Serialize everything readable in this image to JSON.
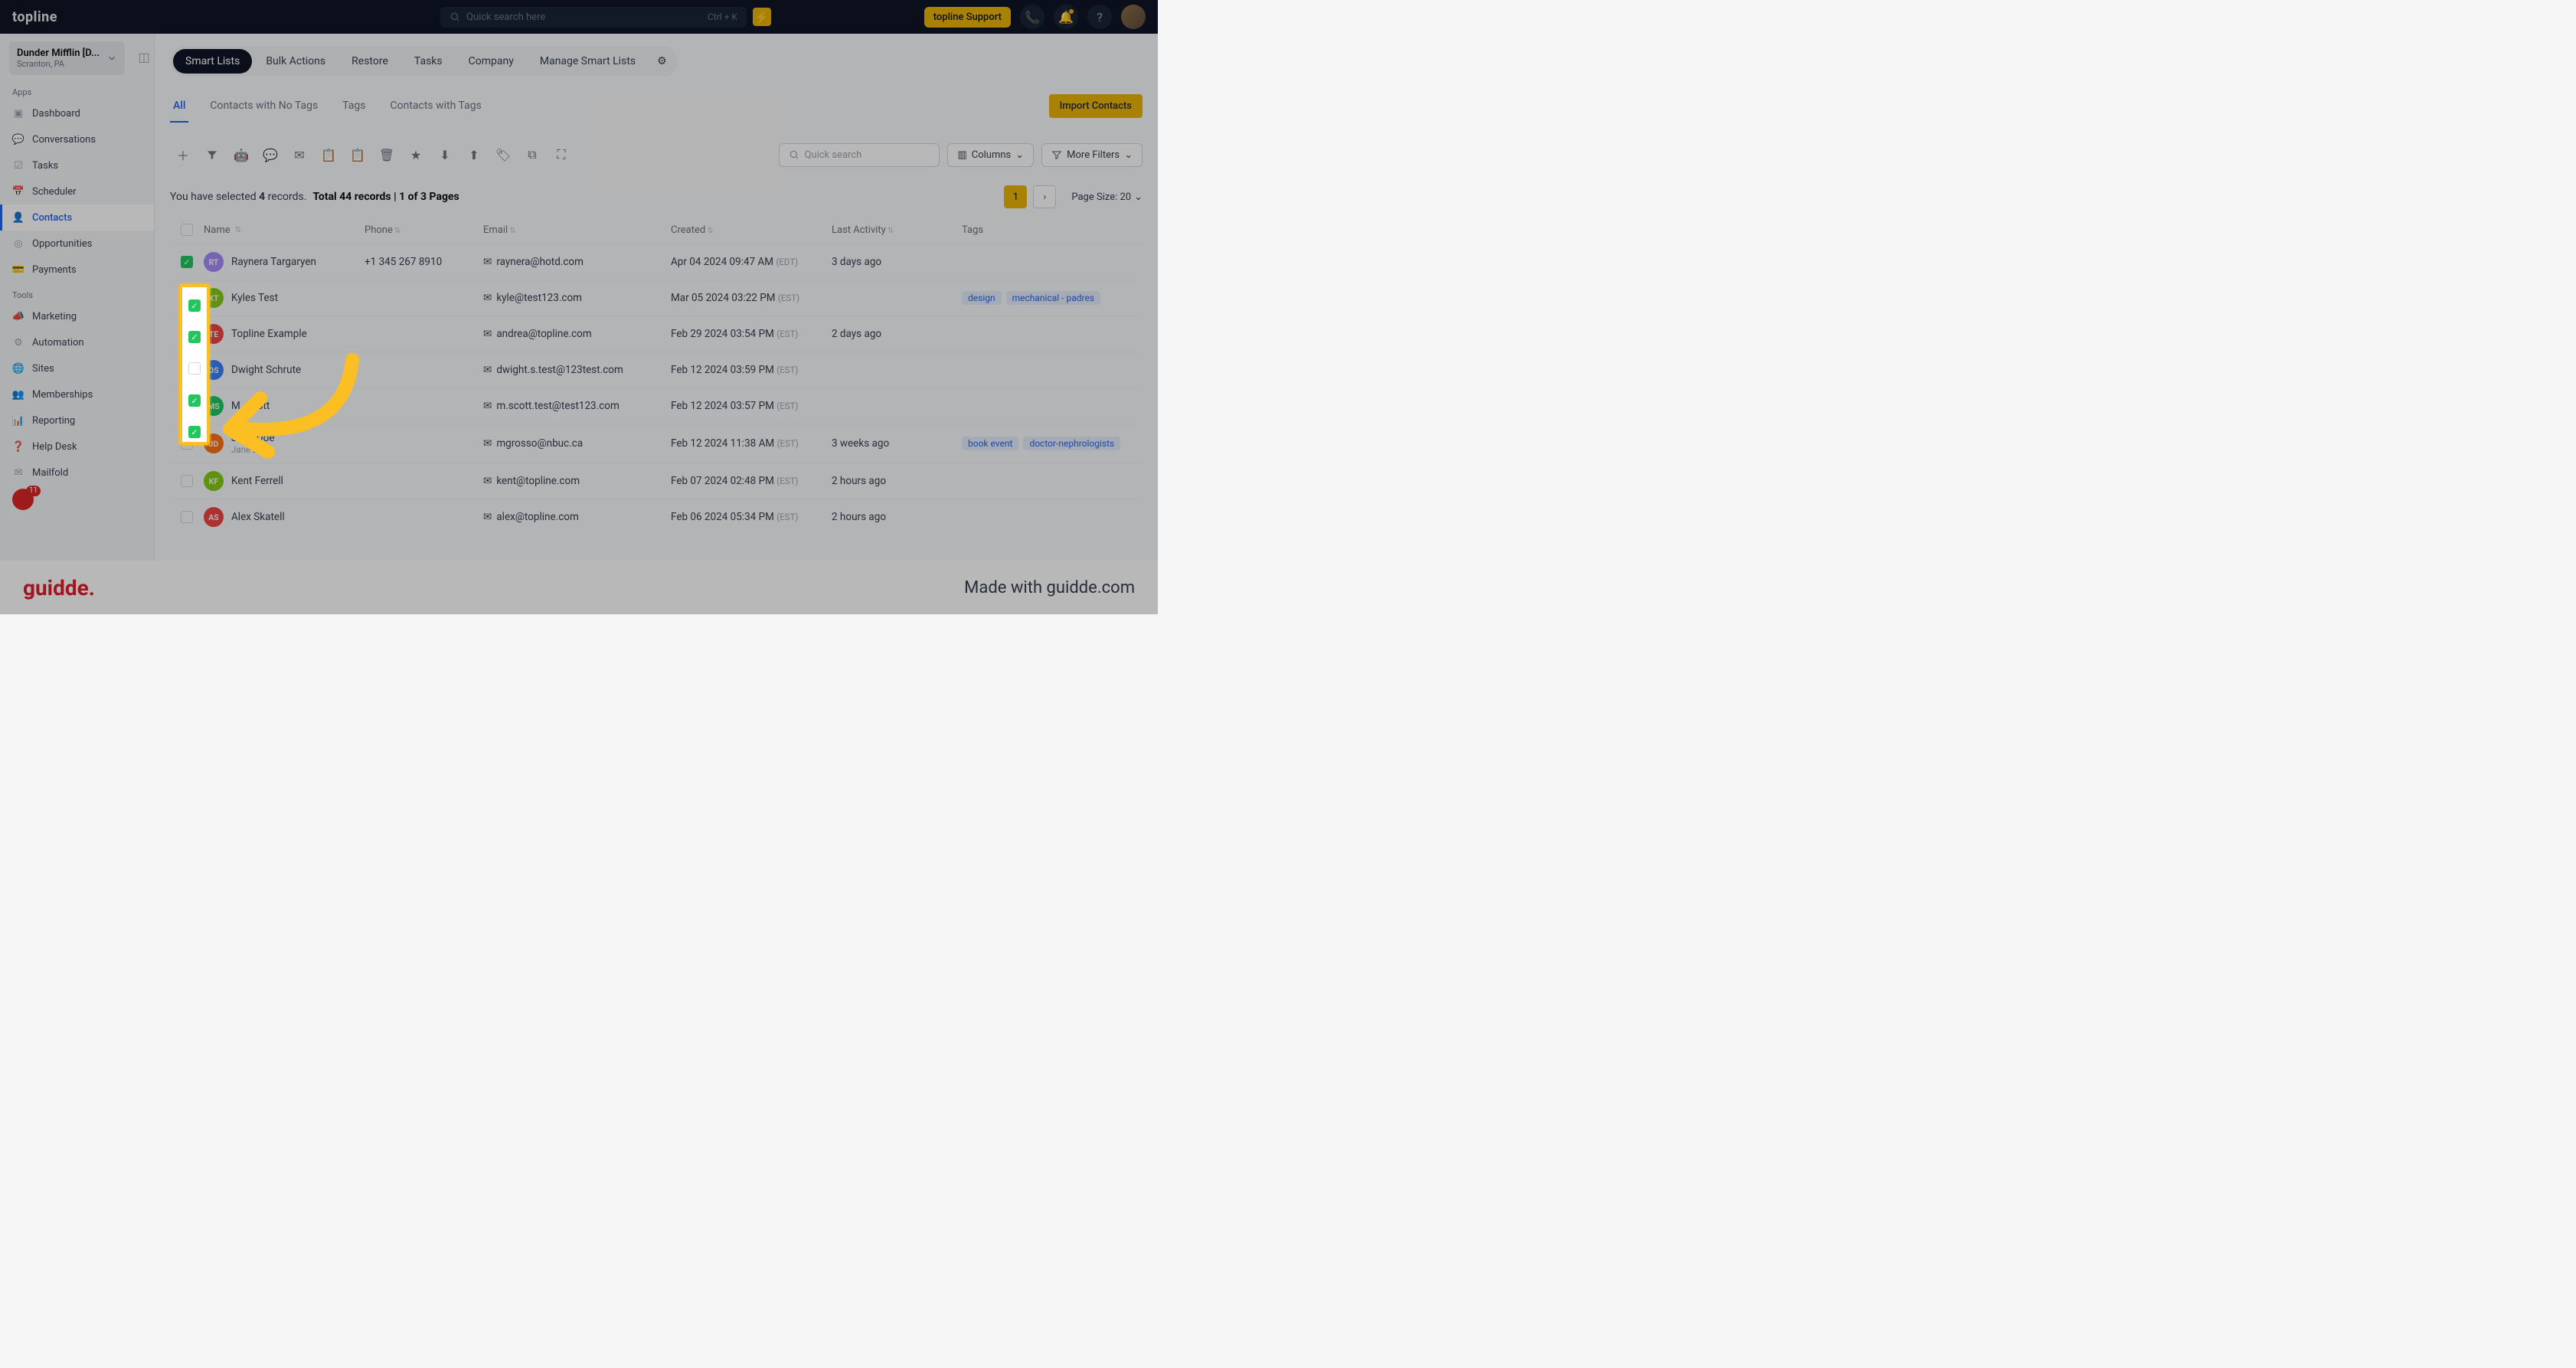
{
  "header": {
    "logo": "topline",
    "search_placeholder": "Quick search here",
    "search_kbd": "Ctrl + K",
    "support_label": "topline Support"
  },
  "sidebar": {
    "account_name": "Dunder Mifflin [D...",
    "account_location": "Scranton, PA",
    "section_apps": "Apps",
    "section_tools": "Tools",
    "apps": [
      {
        "label": "Dashboard",
        "icon": "dashboard"
      },
      {
        "label": "Conversations",
        "icon": "chat"
      },
      {
        "label": "Tasks",
        "icon": "tasks"
      },
      {
        "label": "Scheduler",
        "icon": "calendar"
      },
      {
        "label": "Contacts",
        "icon": "user",
        "active": true
      },
      {
        "label": "Opportunities",
        "icon": "target"
      },
      {
        "label": "Payments",
        "icon": "card"
      }
    ],
    "tools": [
      {
        "label": "Marketing",
        "icon": "megaphone"
      },
      {
        "label": "Automation",
        "icon": "automation"
      },
      {
        "label": "Sites",
        "icon": "globe"
      },
      {
        "label": "Memberships",
        "icon": "members"
      },
      {
        "label": "Reporting",
        "icon": "chart"
      },
      {
        "label": "Help Desk",
        "icon": "help"
      },
      {
        "label": "Mailfold",
        "icon": "mail"
      }
    ],
    "badge_count": "11"
  },
  "nav": {
    "pills": [
      "Smart Lists",
      "Bulk Actions",
      "Restore",
      "Tasks",
      "Company",
      "Manage Smart Lists"
    ],
    "active": "Smart Lists",
    "subtabs": [
      "All",
      "Contacts with No Tags",
      "Tags",
      "Contacts with Tags"
    ],
    "subtab_active": "All",
    "import_label": "Import Contacts"
  },
  "toolbar": {
    "quick_search_placeholder": "Quick search",
    "columns_label": "Columns",
    "filters_label": "More Filters"
  },
  "selection": {
    "prefix": "You have selected ",
    "count": "4",
    "suffix": " records.",
    "total": "Total 44 records",
    "pages": "1 of 3 Pages",
    "page_current": "1",
    "page_size_label": "Page Size: 20"
  },
  "columns": {
    "name": "Name",
    "phone": "Phone",
    "email": "Email",
    "created": "Created",
    "activity": "Last Activity",
    "tags": "Tags"
  },
  "rows": [
    {
      "checked": true,
      "initials": "RT",
      "color": "#a78bfa",
      "name": "Raynera Targaryen",
      "phone": "+1 345 267 8910",
      "email": "raynera@hotd.com",
      "created": "Apr 04 2024 09:47 AM",
      "tz": "(EDT)",
      "activity": "3 days ago",
      "tags": []
    },
    {
      "checked": true,
      "initials": "KT",
      "color": "#84cc16",
      "name": "Kyles Test",
      "phone": "",
      "email": "kyle@test123.com",
      "created": "Mar 05 2024 03:22 PM",
      "tz": "(EST)",
      "activity": "",
      "tags": [
        "design",
        "mechanical - padres"
      ]
    },
    {
      "checked": false,
      "initials": "TE",
      "color": "#ef4444",
      "name": "Topline Example",
      "phone": "",
      "email": "andrea@topline.com",
      "created": "Feb 29 2024 03:54 PM",
      "tz": "(EST)",
      "activity": "2 days ago",
      "tags": []
    },
    {
      "checked": true,
      "initials": "DS",
      "color": "#3b82f6",
      "name": "Dwight Schrute",
      "phone": "",
      "email": "dwight.s.test@123test.com",
      "created": "Feb 12 2024 03:59 PM",
      "tz": "(EST)",
      "activity": "",
      "tags": []
    },
    {
      "checked": true,
      "initials": "MS",
      "color": "#22c55e",
      "name": "M. Scott",
      "phone": "",
      "email": "m.scott.test@test123.com",
      "created": "Feb 12 2024 03:57 PM",
      "tz": "(EST)",
      "activity": "",
      "tags": []
    },
    {
      "checked": false,
      "initials": "JD",
      "color": "#f97316",
      "name": "Jane Doe",
      "sub": "Jane Do",
      "phone": "",
      "email": "mgrosso@nbuc.ca",
      "created": "Feb 12 2024 11:38 AM",
      "tz": "(EST)",
      "activity": "3 weeks ago",
      "tags": [
        "book event",
        "doctor-nephrologists"
      ]
    },
    {
      "checked": false,
      "initials": "KF",
      "color": "#84cc16",
      "name": "Kent Ferrell",
      "phone": "",
      "email": "kent@topline.com",
      "created": "Feb 07 2024 02:48 PM",
      "tz": "(EST)",
      "activity": "2 hours ago",
      "tags": []
    },
    {
      "checked": false,
      "initials": "AS",
      "color": "#ef4444",
      "name": "Alex Skatell",
      "phone": "",
      "email": "alex@topline.com",
      "created": "Feb 06 2024 05:34 PM",
      "tz": "(EST)",
      "activity": "2 hours ago",
      "tags": []
    }
  ],
  "footer": {
    "logo": "guidde.",
    "made_with": "Made with guidde.com"
  }
}
